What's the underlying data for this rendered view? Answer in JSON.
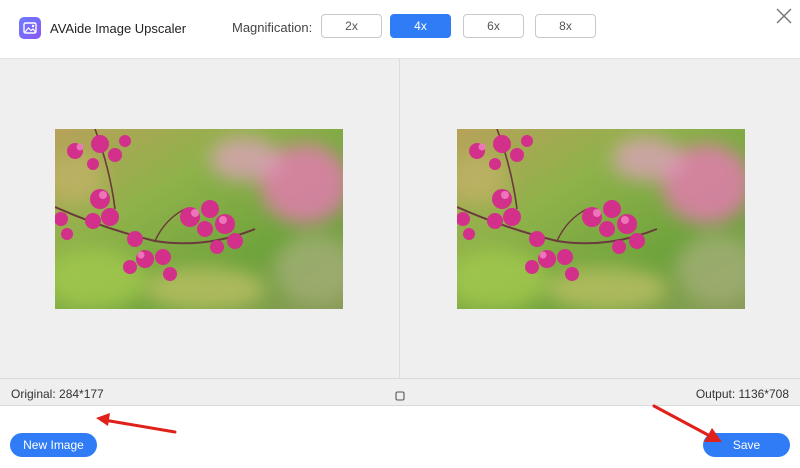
{
  "header": {
    "app_title": "AVAide Image Upscaler",
    "magnification_label": "Magnification:",
    "magnification_options": [
      "2x",
      "4x",
      "6x",
      "8x"
    ],
    "selected_magnification": "4x"
  },
  "info": {
    "original": "Original: 284*177",
    "output": "Output: 1136*708"
  },
  "footer": {
    "new_image_label": "New Image",
    "save_label": "Save"
  },
  "colors": {
    "accent": "#2f7cf6",
    "annotation_arrow": "#e0201a",
    "preview_bg": "#efefef"
  },
  "icons": {
    "logo": "image-upscaler-logo-icon",
    "close": "close-icon",
    "compare": "compare-square-icon"
  }
}
